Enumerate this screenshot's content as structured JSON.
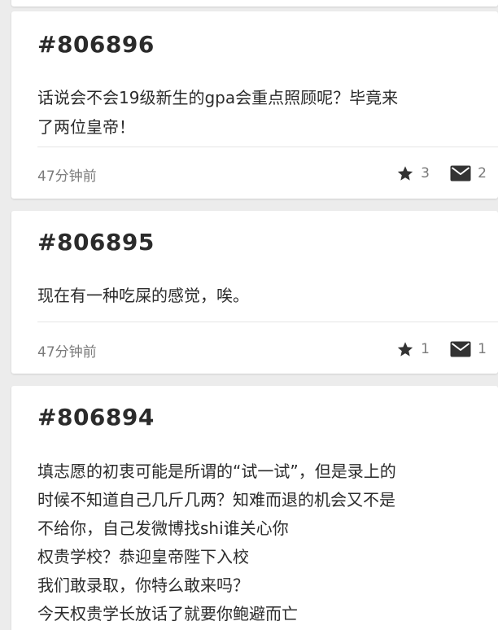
{
  "posts": [
    {
      "id": "#806896",
      "body_lines": [
        "话说会不会19级新生的gpa会重点照顾呢？毕竟来",
        "了两位皇帝！"
      ],
      "time": "47分钟前",
      "stars": "3",
      "comments": "2"
    },
    {
      "id": "#806895",
      "body_lines": [
        "现在有一种吃屎的感觉，唉。"
      ],
      "time": "47分钟前",
      "stars": "1",
      "comments": "1"
    },
    {
      "id": "#806894",
      "body_lines": [
        "填志愿的初衷可能是所谓的“试一试”，但是录上的",
        "时候不知道自己几斤几两？知难而退的机会又不是",
        "不给你，自己发微博找shi谁关心你",
        "权贵学校？恭迎皇帝陛下入校",
        "我们敢录取，你特么敢来吗？",
        "今天权贵学长放话了就要你鲍避而亡"
      ]
    }
  ],
  "icons": {
    "star": "star-icon",
    "mail": "mail-icon"
  },
  "colors": {
    "background": "#ececec",
    "card": "#ffffff",
    "text": "#2b2b2b",
    "meta": "#7a7a7a",
    "icon": "#333333"
  }
}
